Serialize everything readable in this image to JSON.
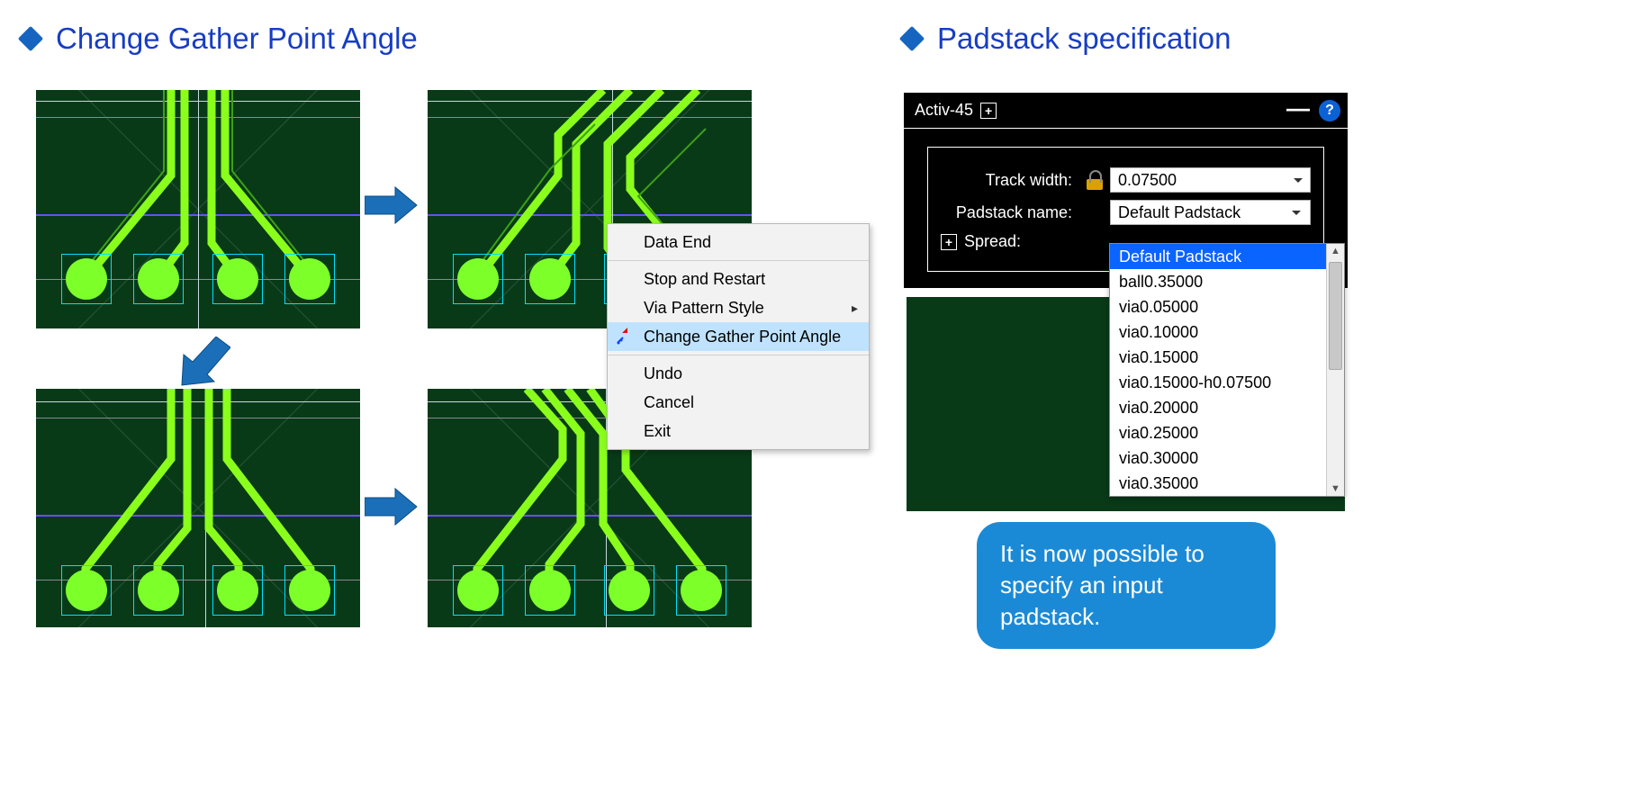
{
  "left_heading": "Change Gather Point Angle",
  "right_heading": "Padstack specification",
  "context_menu": {
    "items": {
      "data_end": "Data End",
      "stop_restart": "Stop and Restart",
      "via_pattern": "Via Pattern Style",
      "change_gp": "Change Gather Point Angle",
      "undo": "Undo",
      "cancel": "Cancel",
      "exit": "Exit"
    }
  },
  "panel": {
    "title": "Activ-45",
    "labels": {
      "track_width": "Track width:",
      "padstack_name": "Padstack name:",
      "spread": "Spread:"
    },
    "values": {
      "track_width": "0.07500",
      "padstack_name": "Default Padstack"
    },
    "dropdown_options": [
      "Default Padstack",
      "ball0.35000",
      "via0.05000",
      "via0.10000",
      "via0.15000",
      "via0.15000-h0.07500",
      "via0.20000",
      "via0.25000",
      "via0.30000",
      "via0.35000"
    ]
  },
  "callout_text": "It is now possible to specify an input padstack."
}
